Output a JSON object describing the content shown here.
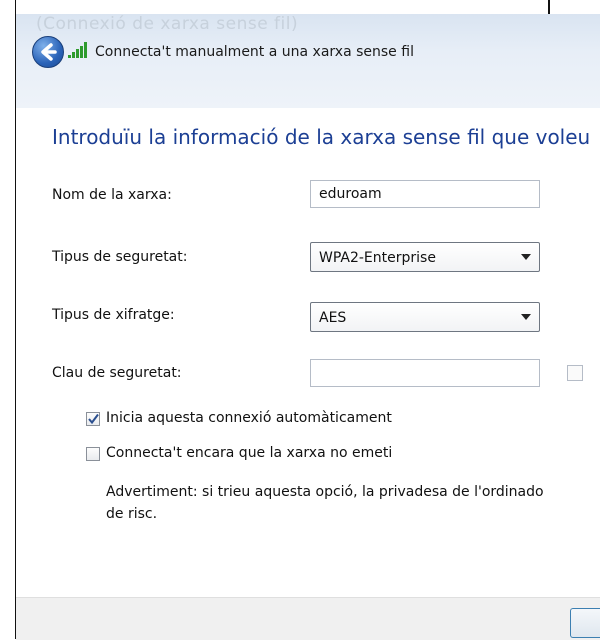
{
  "window": {
    "ghost_title": "(Connexió de xarxa sense fil)",
    "ghost_subtitle": "",
    "header_title": "Connecta't manualment a una xarxa sense fil"
  },
  "content": {
    "heading": "Introduïu la informació de la xarxa sense fil que voleu",
    "network_name": {
      "label": "Nom de la xarxa:",
      "value": "eduroam"
    },
    "security_type": {
      "label": "Tipus de seguretat:",
      "value": "WPA2-Enterprise"
    },
    "encryption_type": {
      "label": "Tipus de xifratge:",
      "value": "AES"
    },
    "security_key": {
      "label": "Clau de seguretat:",
      "value": ""
    },
    "auto_start": {
      "label": "Inicia aquesta connexió automàticament",
      "checked": true
    },
    "connect_hidden": {
      "label": "Connecta't encara que la xarxa no emeti",
      "checked": false
    },
    "warning": {
      "line1": "Advertiment: si trieu aquesta opció, la privadesa de l'ordinado",
      "line2": "de risc."
    }
  },
  "icons": {
    "back": "back-arrow-icon",
    "signal": "wireless-signal-icon",
    "check": "checkmark-icon",
    "dropdown": "chevron-down-icon"
  },
  "colors": {
    "heading": "#1c3f94",
    "titlebar": "#e7eef7",
    "footer": "#f0f0f0"
  }
}
